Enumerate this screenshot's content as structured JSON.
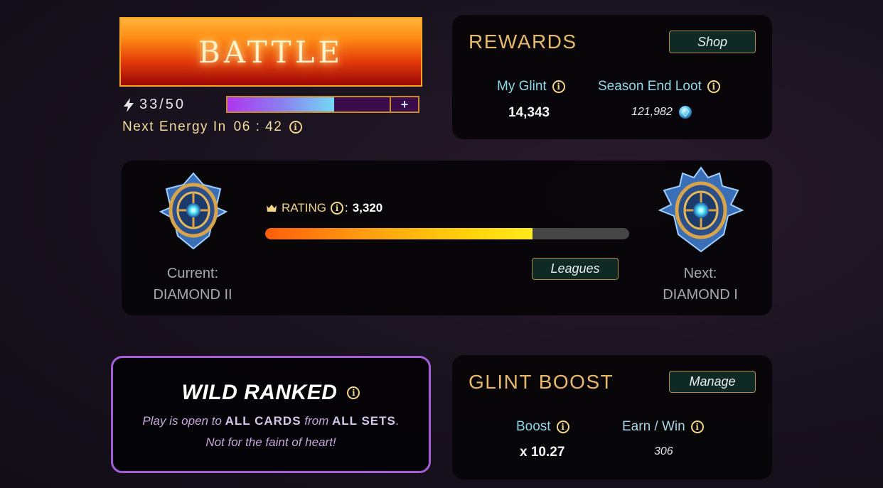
{
  "battle": {
    "label": "BATTLE"
  },
  "energy": {
    "current_text": "33/50",
    "fill_fraction": 0.66,
    "plus_label": "+",
    "next_label": "Next Energy In",
    "next_time": "06 : 42"
  },
  "rewards": {
    "title": "REWARDS",
    "shop_label": "Shop",
    "my_glint_label": "My Glint",
    "my_glint_value": "14,343",
    "season_loot_label": "Season End Loot",
    "season_loot_value": "121,982"
  },
  "rating": {
    "label": "RATING",
    "separator": ":",
    "value": "3,320",
    "progress_fraction": 0.735,
    "current_label": "Current:",
    "current_league": "DIAMOND II",
    "next_label": "Next:",
    "next_league": "DIAMOND I",
    "leagues_button": "Leagues"
  },
  "wild": {
    "title": "WILD RANKED",
    "desc_part1": "Play is open to ",
    "desc_emph1": "ALL CARDS",
    "desc_part2": " from ",
    "desc_emph2": "ALL SETS",
    "desc_part3": ".",
    "desc_line2": "Not for the faint of heart!"
  },
  "glint_boost": {
    "title": "GLINT BOOST",
    "manage_label": "Manage",
    "boost_label": "Boost",
    "boost_value": "x 10.27",
    "earn_label": "Earn / Win",
    "earn_value": "306"
  },
  "icons": {
    "info": "info-circle-icon",
    "bolt": "lightning-bolt-icon",
    "crown": "crown-icon",
    "gem": "glint-gem-icon",
    "badge": "diamond-league-badge-icon"
  },
  "colors": {
    "gold": "#e8b86a",
    "teal_label": "#8fd6e6",
    "purple_border": "#a45cd8",
    "battle_orange": "#ff8a12"
  }
}
